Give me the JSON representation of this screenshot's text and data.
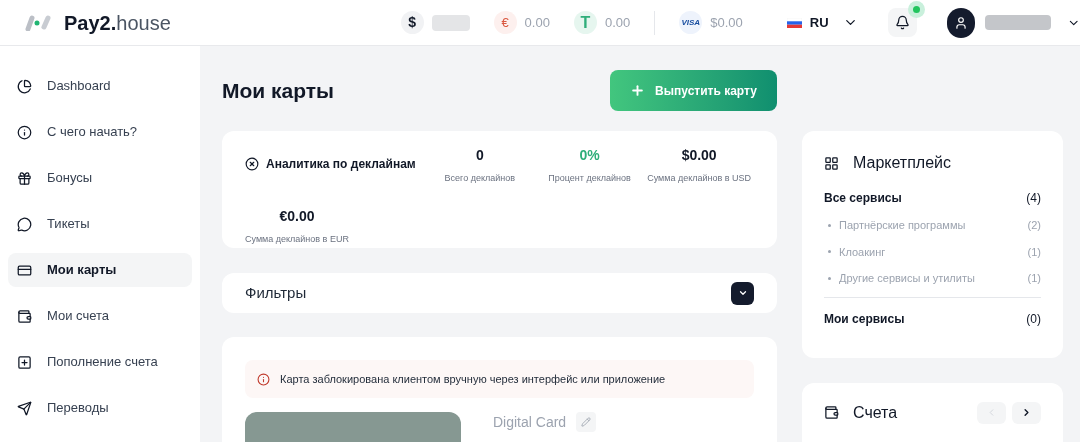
{
  "header": {
    "logo": "**Pay2.**house",
    "balances": [
      {
        "kind": "usd",
        "symbol": "$"
      },
      {
        "kind": "eur",
        "symbol": "€",
        "value": "0.00"
      },
      {
        "kind": "usdt",
        "symbol": "T",
        "value": "0.00"
      },
      {
        "kind": "visa",
        "symbol": "VISA",
        "value": "$0.00"
      }
    ],
    "language": "RU",
    "notification_dot": true
  },
  "sidebar": {
    "items": [
      {
        "label": "Dashboard",
        "selected": false
      },
      {
        "label": "С чего начать?",
        "selected": false
      },
      {
        "label": "Бонусы",
        "selected": false
      },
      {
        "label": "Тикеты",
        "selected": false
      },
      {
        "label": "Мои карты",
        "selected": true
      },
      {
        "label": "Мои счета",
        "selected": false
      },
      {
        "label": "Пополнение счета",
        "selected": false
      },
      {
        "label": "Переводы",
        "selected": false
      }
    ]
  },
  "page": {
    "title": "Мои карты",
    "issue_button": "Выпустить карту",
    "analytics": {
      "title": "Аналитика по деклайнам",
      "stats": [
        {
          "value": "0",
          "label": "Всего деклайнов",
          "accent": false
        },
        {
          "value": "0%",
          "label": "Процент деклайнов",
          "accent": true
        },
        {
          "value": "$0.00",
          "label": "Сумма деклайнов в USD",
          "accent": false
        },
        {
          "value": "€0.00",
          "label": "Сумма деклайнов в EUR",
          "accent": false
        }
      ]
    },
    "filters": {
      "title": "Фильтры",
      "expanded": false
    },
    "card": {
      "alert": "Карта заблокирована клиентом вручную через интерфейс или приложение",
      "name": "Digital Card"
    }
  },
  "marketplace": {
    "title": "Маркетплейс",
    "groups": [
      {
        "label": "Все сервисы",
        "count": "(4)",
        "children": [
          {
            "label": "Партнёрские программы",
            "count": "(2)"
          },
          {
            "label": "Клоакинг",
            "count": "(1)"
          },
          {
            "label": "Другие сервисы и утилиты",
            "count": "(1)"
          }
        ]
      },
      {
        "label": "Мои сервисы",
        "count": "(0)"
      }
    ]
  },
  "accounts": {
    "title": "Счета",
    "prev_disabled": true,
    "next_disabled": false
  }
}
